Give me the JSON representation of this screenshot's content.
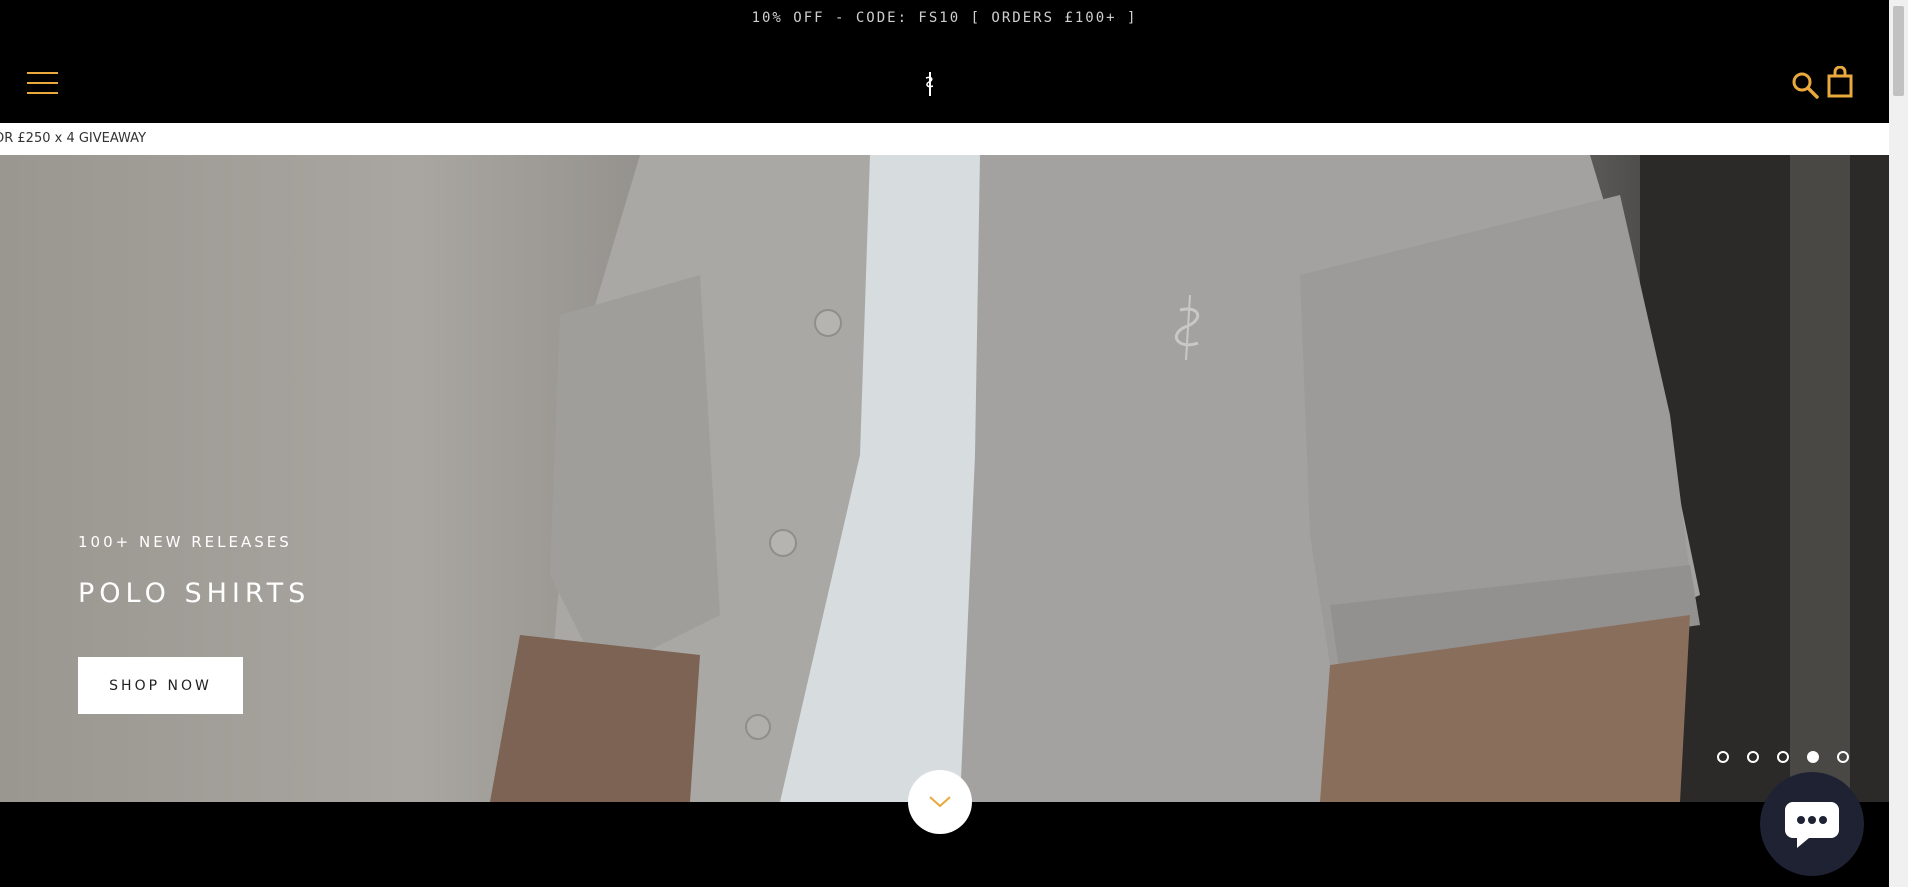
{
  "announcement": {
    "text": "10% OFF - CODE: FS10 [ ORDERS £100+ ]"
  },
  "header": {
    "menu_icon": "hamburger-menu-icon",
    "logo_icon": "brand-logo-icon",
    "search_icon": "search-icon",
    "cart_icon": "shopping-bag-icon",
    "accent_color": "#e9a93c"
  },
  "marquee": {
    "text": "OR £250 x 4 GIVEAWAY"
  },
  "hero": {
    "subtitle": "100+ NEW RELEASES",
    "title": "POLO SHIRTS",
    "cta_label": "SHOP NOW",
    "slides_total": 5,
    "active_slide": 4
  },
  "scroll_down_icon": "chevron-down-icon",
  "chat_icon": "chat-bubble-icon"
}
